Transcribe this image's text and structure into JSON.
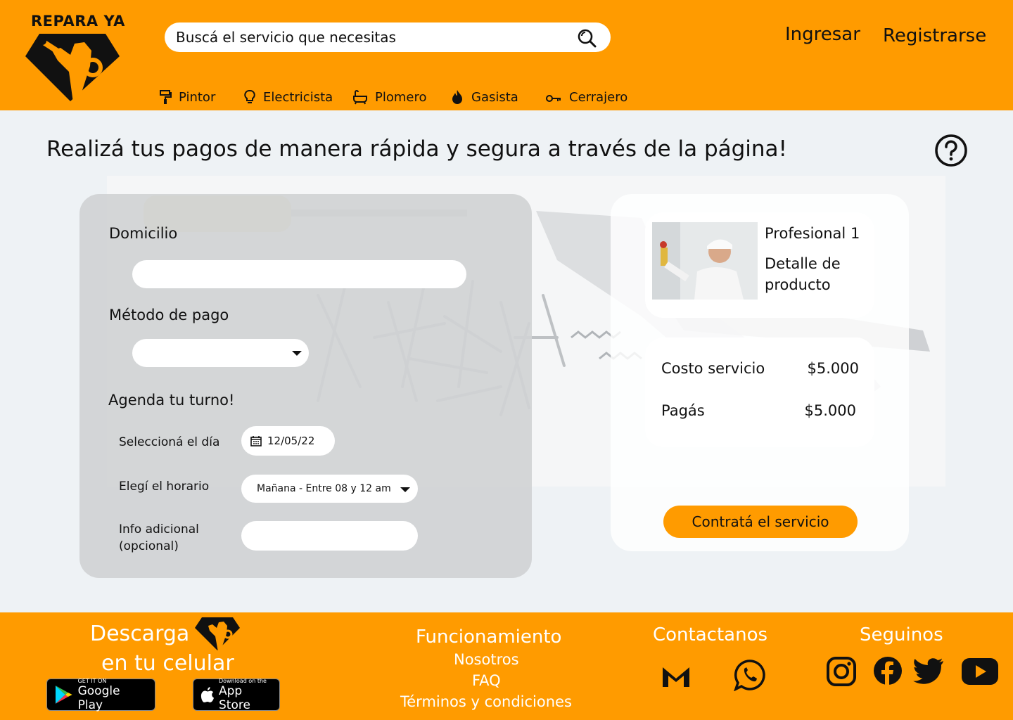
{
  "brand": {
    "name": "REPARA YA"
  },
  "header": {
    "search_placeholder": "Buscá el servicio que necesitas",
    "login": "Ingresar",
    "register": "Registrarse",
    "categories": [
      {
        "label": "Pintor",
        "icon": "paint-roller-icon"
      },
      {
        "label": "Electricista",
        "icon": "lightbulb-icon"
      },
      {
        "label": "Plomero",
        "icon": "bathtub-icon"
      },
      {
        "label": "Gasista",
        "icon": "flame-icon"
      },
      {
        "label": "Cerrajero",
        "icon": "key-icon"
      }
    ]
  },
  "main": {
    "title": "Realizá tus pagos de manera rápida y segura a través de la página!",
    "form": {
      "address_label": "Domicilio",
      "address_value": "",
      "payment_label": "Método de pago",
      "payment_value": "",
      "schedule_label": "Agenda tu turno!",
      "day_label": "Seleccioná el día",
      "day_value": "12/05/22",
      "time_label": "Elegí el horario",
      "time_value": "Mañana - Entre 08 y 12 am",
      "info_label": "Info adicional (opcional)",
      "info_value": ""
    },
    "summary": {
      "professional_name": "Profesional 1",
      "product_detail": "Detalle de producto",
      "cost_label": "Costo servicio",
      "cost_value": "$5.000",
      "pay_label": "Pagás",
      "pay_value": "$5.000",
      "cta": "Contratá el servicio"
    }
  },
  "footer": {
    "download_line1": "Descarga",
    "download_line2": "en tu celular",
    "google_play_small": "GET IT ON",
    "google_play_big": "Google Play",
    "app_store_small": "Download on the",
    "app_store_big": "App Store",
    "how_title": "Funcionamiento",
    "links": [
      "Nosotros",
      "FAQ",
      "Términos y condiciones"
    ],
    "contact_title": "Contactanos",
    "follow_title": "Seguinos"
  },
  "colors": {
    "brand": "#ff9b00",
    "background": "#eef2f5",
    "card": "#d0d2d4"
  }
}
